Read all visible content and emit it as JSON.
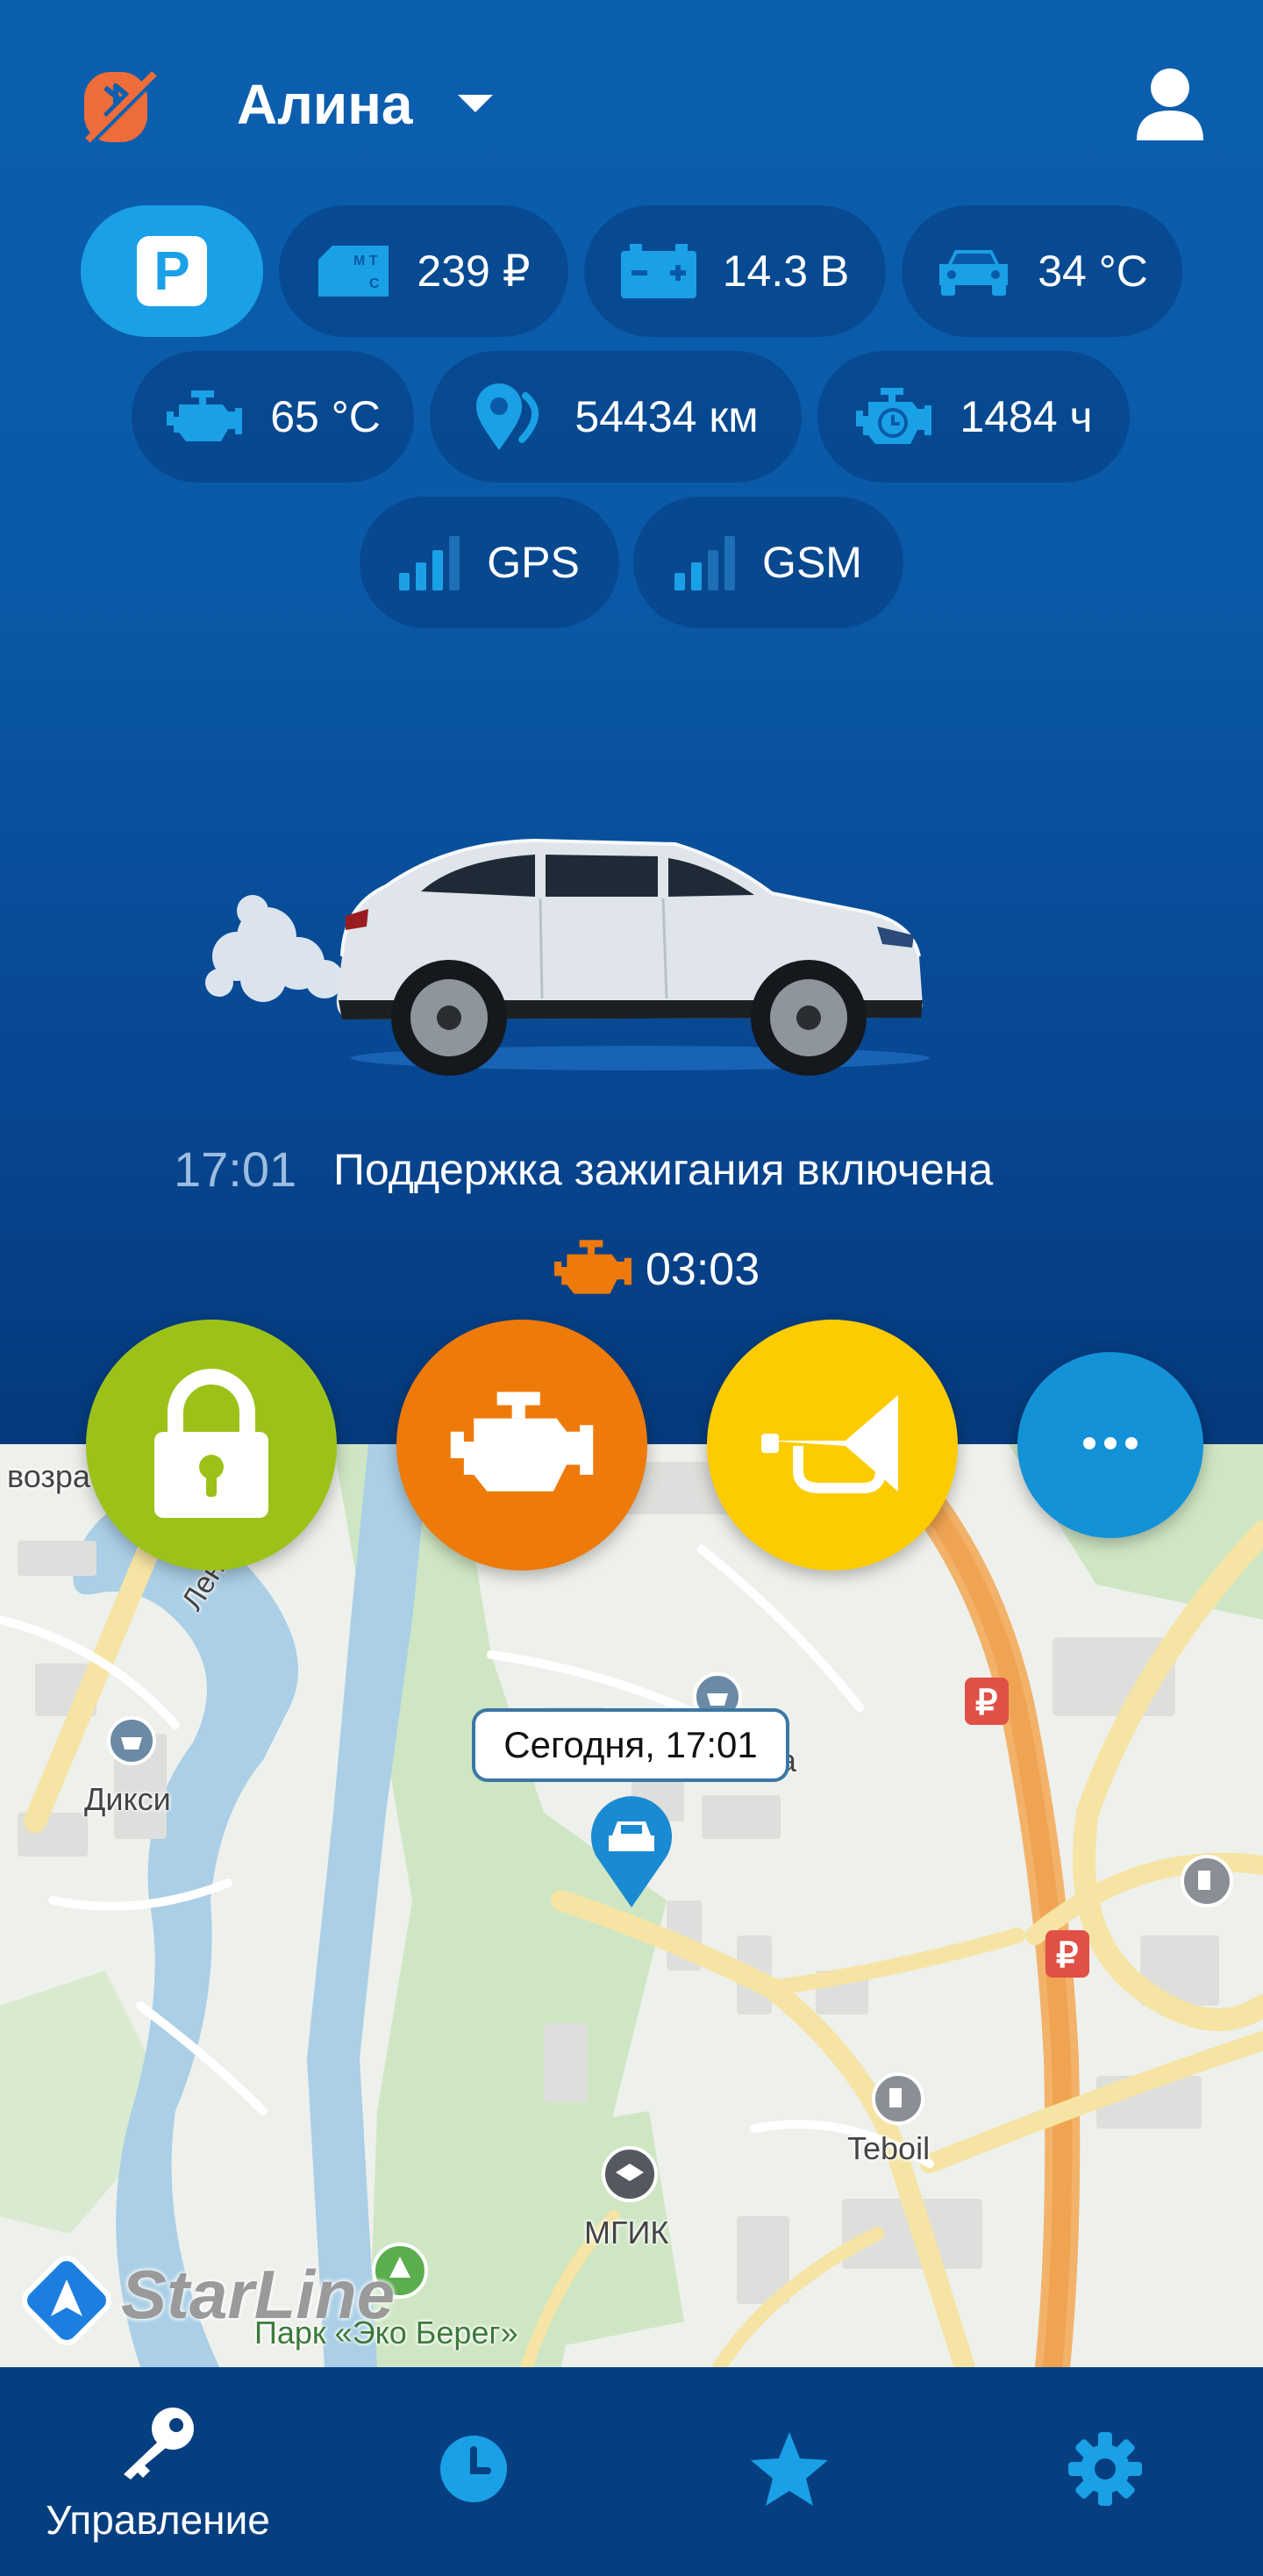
{
  "header": {
    "username": "Алина",
    "icons": {
      "logo": "bluetooth-off-icon",
      "user": "user-icon",
      "dropdown": "chevron-down-icon"
    }
  },
  "chips": {
    "parking": {
      "label": "P"
    },
    "balance": {
      "value": "239 ₽",
      "icon": "sim-card-icon"
    },
    "battery": {
      "value": "14.3 В",
      "icon": "battery-icon"
    },
    "cabin_temp": {
      "value": "34 °C",
      "icon": "car-icon"
    },
    "engine_temp": {
      "value": "65 °C",
      "icon": "engine-icon"
    },
    "mileage": {
      "value": "54434 км",
      "icon": "location-pin-icon"
    },
    "engine_hours": {
      "value": "1484 ч",
      "icon": "engine-clock-icon"
    },
    "gps": {
      "value": "GPS",
      "icon": "signal-icon"
    },
    "gsm": {
      "value": "GSM",
      "icon": "signal-icon"
    }
  },
  "status": {
    "time": "17:01",
    "message": "Поддержка зажигания включена",
    "timer": "03:03"
  },
  "actions": {
    "lock": "lock-icon",
    "engine": "engine-icon",
    "horn": "horn-icon",
    "more": "more-icon"
  },
  "map": {
    "bubble": "Сегодня, 17:01",
    "labels": {
      "dixi": "Дикси",
      "teboil": "Teboil",
      "mgik": "МГИК",
      "park": "Парк «Эко Берег»",
      "prospect": "Ленинский просп.",
      "vozra": "возра",
      "partial_a": "а"
    },
    "brand": "StarLine"
  },
  "nav": {
    "items": [
      {
        "label": "Управление",
        "icon": "key-icon"
      },
      {
        "label": "",
        "icon": "clock-icon"
      },
      {
        "label": "",
        "icon": "star-icon"
      },
      {
        "label": "",
        "icon": "gear-icon"
      }
    ]
  },
  "colors": {
    "header_bg": "#0b5fae",
    "accent_blue": "#1aa0e6",
    "lock_green": "#9cc21a",
    "engine_orange": "#ee7a0a",
    "horn_yellow": "#fdcc00",
    "more_blue": "#1392d7",
    "nav_bg": "#063f80"
  }
}
